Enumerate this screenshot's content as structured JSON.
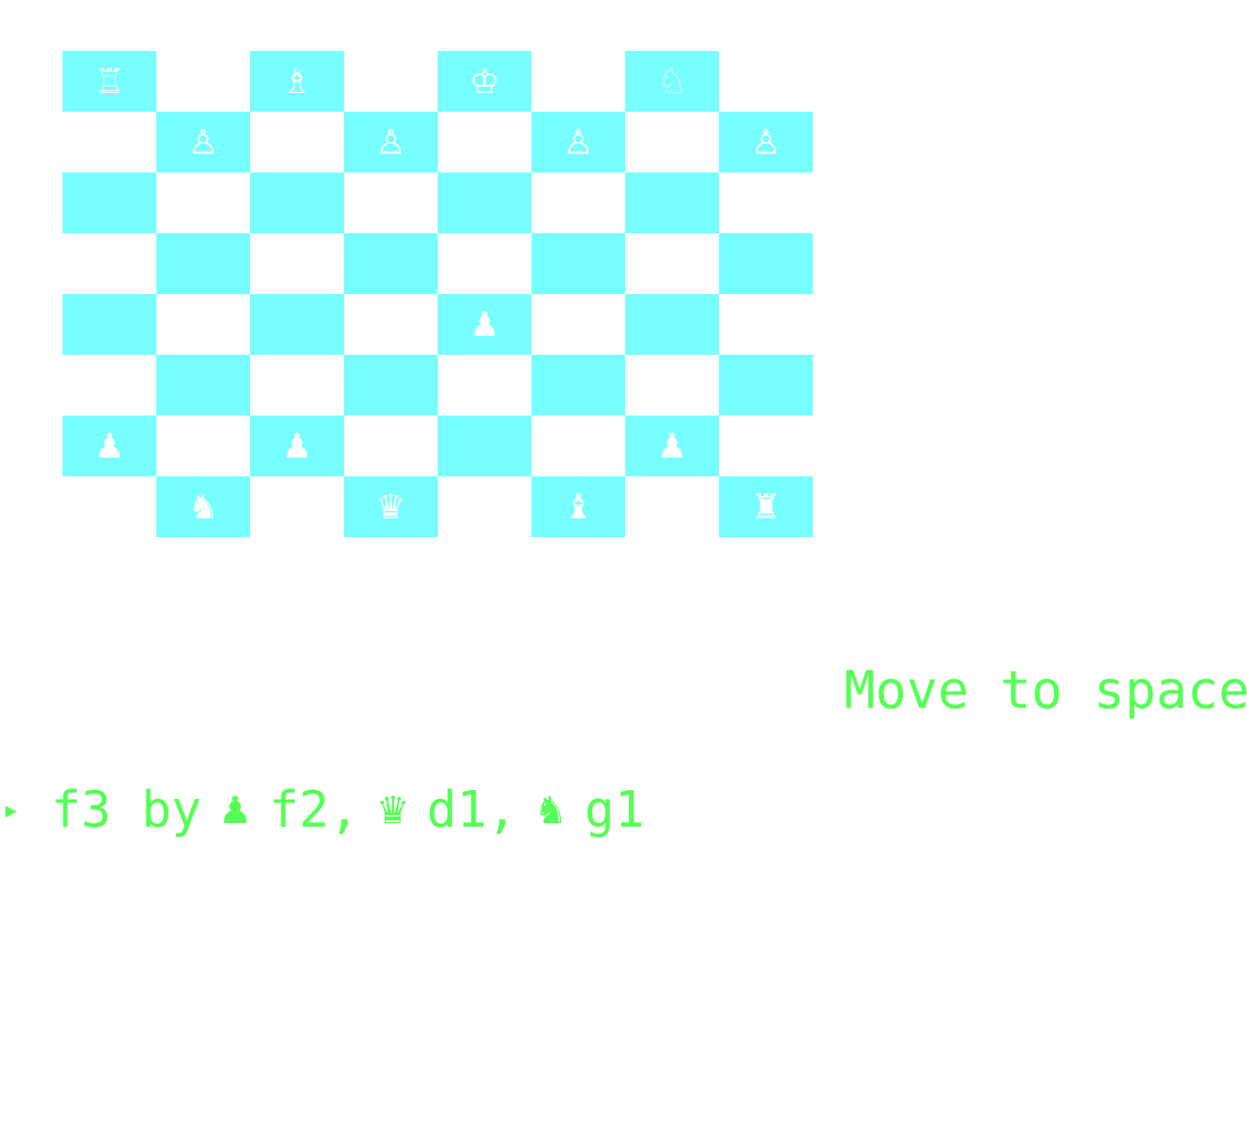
{
  "colors": {
    "dark_square": "#77ffff",
    "light_square": "#ffffff",
    "piece": "#ffffff",
    "text": "#55ff55"
  },
  "board": {
    "rows": [
      [
        {
          "piece": "♖",
          "name": "white-rook"
        },
        null,
        {
          "piece": "♗",
          "name": "white-bishop"
        },
        null,
        {
          "piece": "♔",
          "name": "white-king"
        },
        null,
        {
          "piece": "♘",
          "name": "white-knight"
        },
        null
      ],
      [
        null,
        {
          "piece": "♙",
          "name": "white-pawn"
        },
        null,
        {
          "piece": "♙",
          "name": "white-pawn"
        },
        null,
        {
          "piece": "♙",
          "name": "white-pawn"
        },
        null,
        {
          "piece": "♙",
          "name": "white-pawn"
        }
      ],
      [
        null,
        null,
        null,
        null,
        null,
        null,
        null,
        null
      ],
      [
        null,
        null,
        null,
        null,
        null,
        null,
        null,
        null
      ],
      [
        null,
        null,
        null,
        null,
        {
          "piece": "♟",
          "name": "black-pawn"
        },
        null,
        null,
        null
      ],
      [
        null,
        null,
        null,
        null,
        null,
        null,
        null,
        null
      ],
      [
        {
          "piece": "♟",
          "name": "black-pawn"
        },
        null,
        {
          "piece": "♟",
          "name": "black-pawn"
        },
        null,
        null,
        null,
        {
          "piece": "♟",
          "name": "black-pawn"
        },
        null
      ],
      [
        null,
        {
          "piece": "♞",
          "name": "black-knight"
        },
        null,
        {
          "piece": "♛",
          "name": "black-queen"
        },
        null,
        {
          "piece": "♝",
          "name": "black-bishop"
        },
        null,
        {
          "piece": "♜",
          "name": "black-rook"
        }
      ]
    ],
    "dark_parity": 0
  },
  "prompt": {
    "label": "Move to space"
  },
  "move_option": {
    "arrow": "▸",
    "target": "f3 by",
    "sources": [
      {
        "piece": "♟",
        "icon": "black-pawn-icon",
        "square": "f2,"
      },
      {
        "piece": "♛",
        "icon": "black-queen-icon",
        "square": "d1,"
      },
      {
        "piece": "♞",
        "icon": "black-knight-icon",
        "square": "g1"
      }
    ]
  }
}
